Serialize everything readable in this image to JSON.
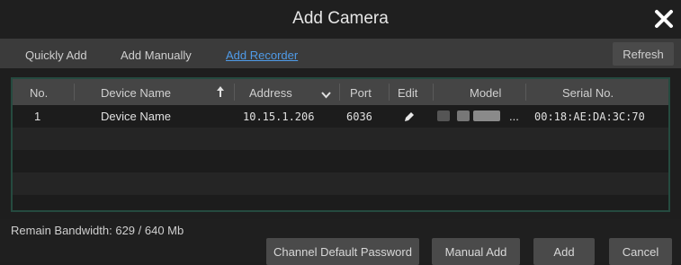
{
  "title": "Add Camera",
  "tabs": [
    {
      "label": "Quickly Add"
    },
    {
      "label": "Add Manually"
    },
    {
      "label": "Add Recorder"
    }
  ],
  "refresh_label": "Refresh",
  "table": {
    "headers": {
      "no": "No.",
      "device_name": "Device Name",
      "address": "Address",
      "port": "Port",
      "edit": "Edit",
      "model": "Model",
      "serial": "Serial No."
    },
    "rows": [
      {
        "no": "1",
        "device_name": "Device Name",
        "address": "10.15.1.206",
        "port": "6036",
        "model_suffix": "...",
        "serial": "00:18:AE:DA:3C:70"
      }
    ]
  },
  "bandwidth_text": "Remain Bandwidth: 629 / 640 Mb",
  "buttons": {
    "channel_default_password": "Channel Default Password",
    "manual_add": "Manual Add",
    "add": "Add",
    "cancel": "Cancel"
  },
  "colors": {
    "accent_link": "#4f9be8",
    "table_border": "#254a3f"
  }
}
